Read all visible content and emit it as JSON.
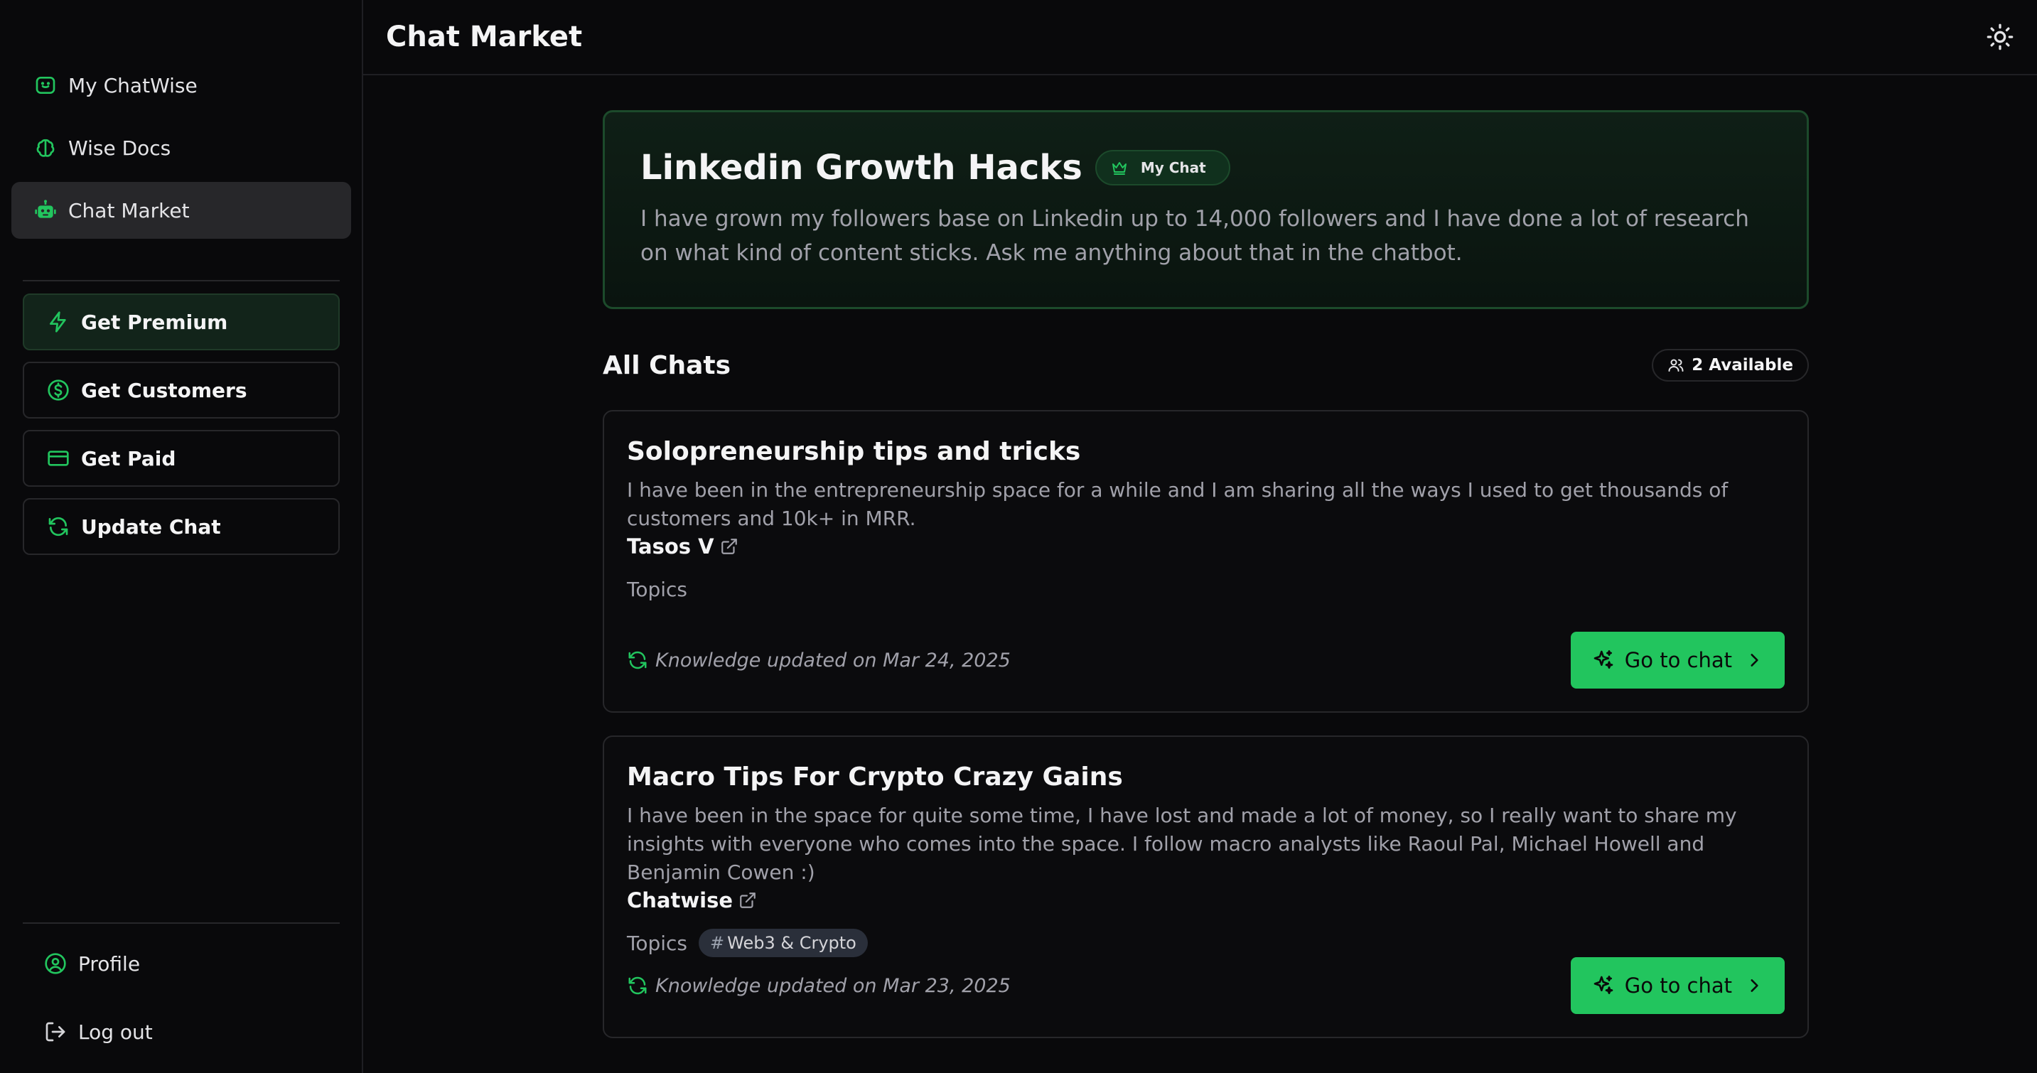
{
  "colors": {
    "accent": "#22c55e",
    "background": "#09090b",
    "muted_text": "#a1a1aa"
  },
  "sidebar": {
    "nav": [
      {
        "label": "My ChatWise",
        "icon": "chat-bubble-icon"
      },
      {
        "label": "Wise Docs",
        "icon": "brain-icon"
      },
      {
        "label": "Chat Market",
        "icon": "robot-icon",
        "active": true
      }
    ],
    "actions": [
      {
        "label": "Get Premium",
        "icon": "lightning-icon"
      },
      {
        "label": "Get Customers",
        "icon": "dollar-circle-icon"
      },
      {
        "label": "Get Paid",
        "icon": "credit-card-icon"
      },
      {
        "label": "Update Chat",
        "icon": "refresh-icon"
      }
    ],
    "bottom": [
      {
        "label": "Profile",
        "icon": "user-circle-icon"
      },
      {
        "label": "Log out",
        "icon": "logout-icon"
      }
    ]
  },
  "header": {
    "title": "Chat Market",
    "theme_icon": "sun-icon"
  },
  "hero": {
    "title": "Linkedin Growth Hacks",
    "badge": "My Chat",
    "badge_icon": "crown-icon",
    "description": "I have grown my followers base on Linkedin up to 14,000 followers and I have done a lot of research on what kind of content sticks. Ask me anything about that in the chatbot."
  },
  "section": {
    "title": "All Chats",
    "available": "2 Available",
    "available_icon": "users-icon"
  },
  "cards": [
    {
      "title": "Solopreneurship tips and tricks",
      "description": "I have been in the entrepreneurship space for a while and I am sharing all the ways I used to get thousands of customers and 10k+ in MRR.",
      "author": "Tasos V",
      "topics_label": "Topics",
      "tags": [],
      "updated": "Knowledge updated on Mar 24, 2025",
      "button": "Go to chat"
    },
    {
      "title": "Macro Tips For Crypto Crazy Gains",
      "description": "I have been in the space for quite some time, I have lost and made a lot of money, so I really want to share my insights with everyone who comes into the space. I follow macro analysts like Raoul Pal, Michael Howell and Benjamin Cowen :)",
      "author": "Chatwise",
      "topics_label": "Topics",
      "tags": [
        {
          "hash": "#",
          "label": "Web3 & Crypto"
        }
      ],
      "updated": "Knowledge updated on Mar 23, 2025",
      "button": "Go to chat"
    }
  ]
}
